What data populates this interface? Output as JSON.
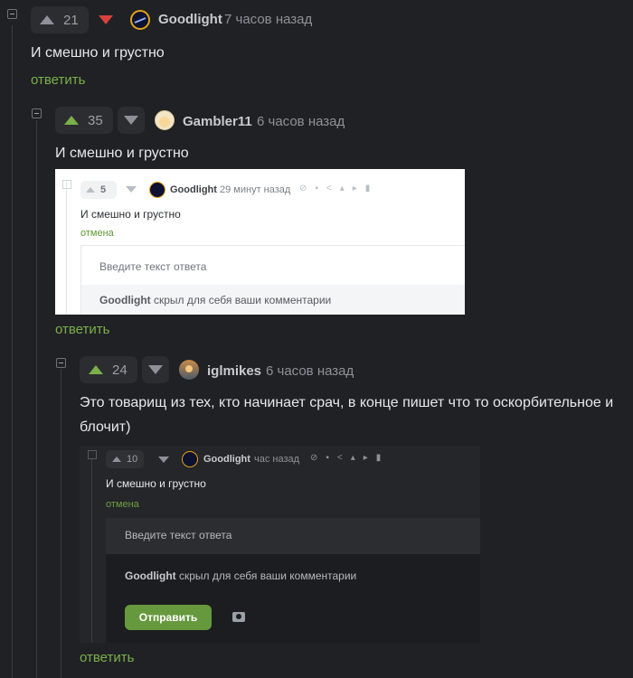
{
  "comments": [
    {
      "votes": "21",
      "author": "Goodlight",
      "time": "7 часов назад",
      "text": "И смешно и грустно",
      "reply_label": "ответить"
    },
    {
      "votes": "35",
      "author": "Gambler11",
      "time": "6 часов назад",
      "text": "И смешно и грустно",
      "reply_label": "ответить",
      "screenshot": {
        "votes": "5",
        "author": "Goodlight",
        "time": "29 минут назад",
        "text": "И смешно и грустно",
        "cancel": "отмена",
        "input_placeholder": "Введите текст ответа",
        "hidden_author": "Goodlight",
        "hidden_text": "скрыл для себя ваши комментарии"
      }
    },
    {
      "votes": "24",
      "author": "iglmikes",
      "time": "6 часов назад",
      "text": "Это товарищ из тех, кто начинает срач, в конце пишет что то оскорбительное и блочит)",
      "reply_label": "ответить",
      "screenshot": {
        "votes": "10",
        "author": "Goodlight",
        "time": "час назад",
        "text": "И смешно и грустно",
        "cancel": "отмена",
        "input_placeholder": "Введите текст ответа",
        "hidden_author": "Goodlight",
        "hidden_text": "скрыл для себя ваши комментарии",
        "send_label": "Отправить"
      }
    }
  ],
  "colors": {
    "accent_green": "#7ab04a",
    "downvote_red": "#d8413d",
    "background": "#202124"
  }
}
